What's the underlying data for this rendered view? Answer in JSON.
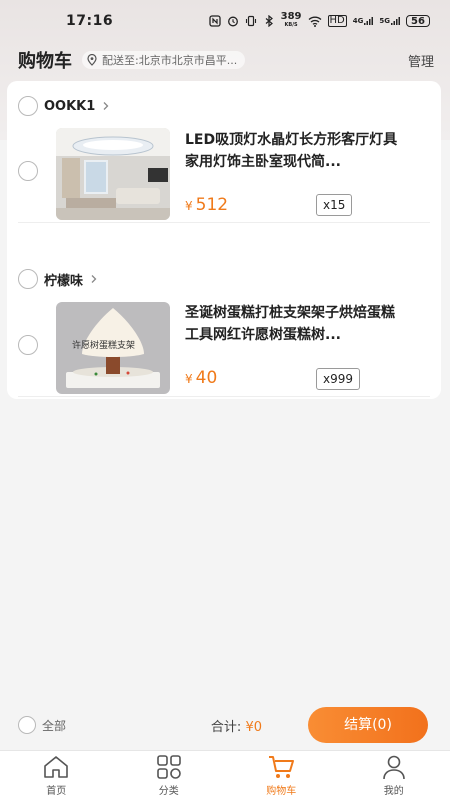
{
  "status_bar": {
    "time": "17:16",
    "speed_top": "389",
    "speed_bottom": "KB/S",
    "hd": "HD",
    "net1": "4G",
    "net2": "5G",
    "battery": "56"
  },
  "header": {
    "title": "购物车",
    "address": "配送至:北京市北京市昌平...",
    "manage": "管理"
  },
  "shops": [
    {
      "name": "OOKK1",
      "items": [
        {
          "title": "LED吸顶灯水晶灯长方形客厅灯具家用灯饰主卧室现代简...",
          "currency": "¥",
          "price": "512",
          "qty": "x15"
        }
      ]
    },
    {
      "name": "柠檬味",
      "items": [
        {
          "title": "圣诞树蛋糕打桩支架架子烘焙蛋糕工具网红许愿树蛋糕树...",
          "currency": "¥",
          "price": "40",
          "qty": "x999",
          "thumb_caption": "许愿树蛋糕支架"
        }
      ]
    }
  ],
  "summary": {
    "select_all": "全部",
    "total_label": "合计:",
    "total_value": "¥0",
    "checkout": "结算(0)"
  },
  "tabs": [
    {
      "label": "首页",
      "icon": "home-icon"
    },
    {
      "label": "分类",
      "icon": "category-icon"
    },
    {
      "label": "购物车",
      "icon": "cart-icon"
    },
    {
      "label": "我的",
      "icon": "profile-icon"
    }
  ],
  "colors": {
    "accent": "#f07a1a",
    "background": "#f4f4f4"
  }
}
